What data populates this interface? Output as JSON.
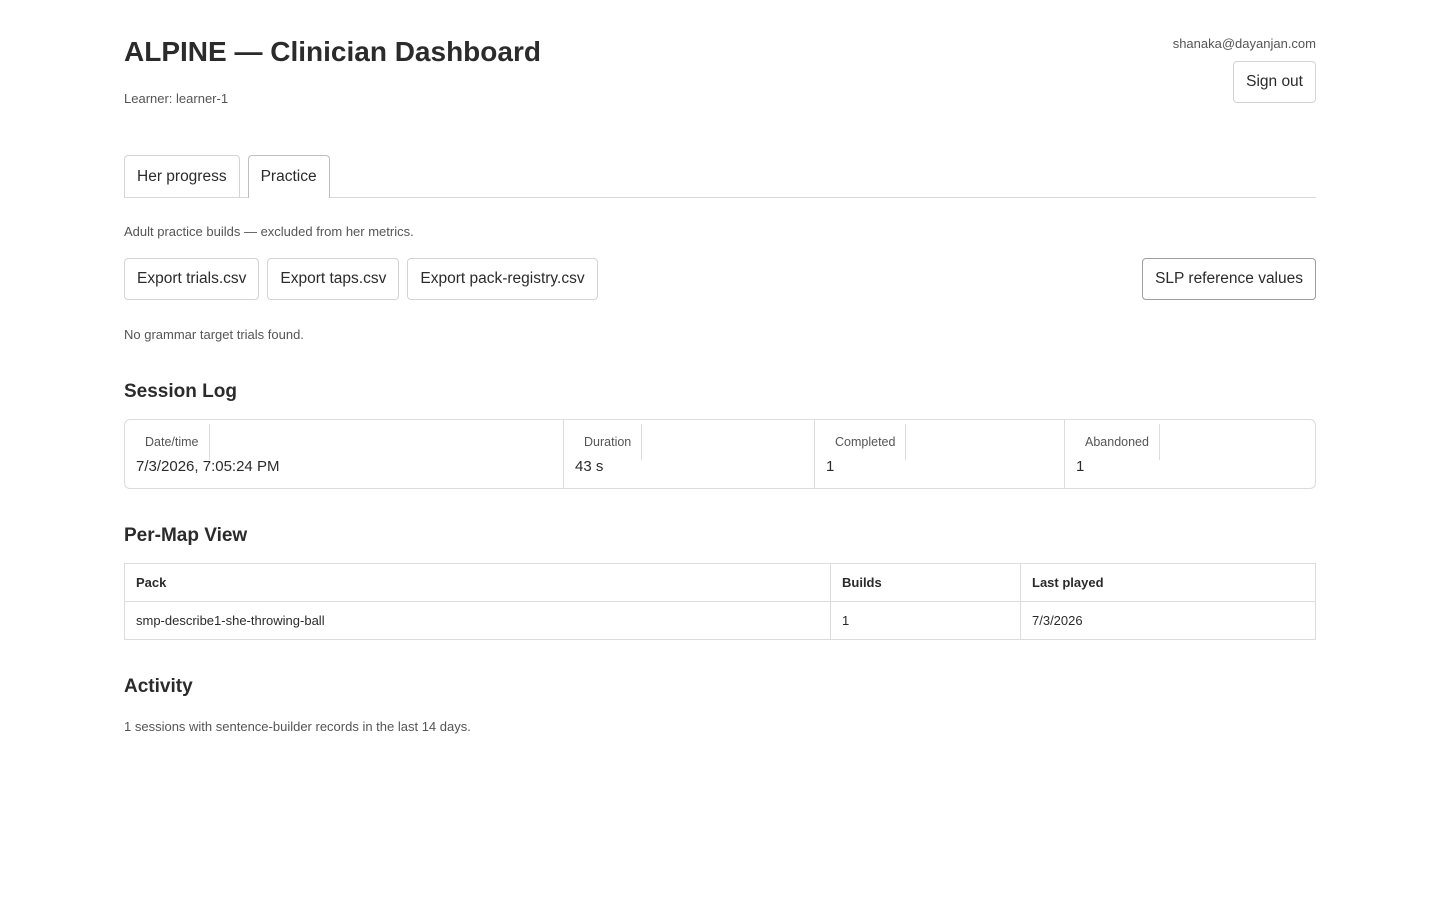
{
  "header": {
    "title": "ALPINE — Clinician Dashboard",
    "learner": "Learner: learner-1",
    "user_email": "shanaka@dayanjan.com",
    "sign_out_label": "Sign out"
  },
  "tabs": [
    {
      "label": "Her progress",
      "active": false
    },
    {
      "label": "Practice",
      "active": true
    }
  ],
  "practice": {
    "note": "Adult practice builds — excluded from her metrics.",
    "export_buttons": [
      "Export trials.csv",
      "Export taps.csv",
      "Export pack-registry.csv"
    ],
    "slp_button": "SLP reference values",
    "empty_message": "No grammar target trials found."
  },
  "session_log": {
    "title": "Session Log",
    "headers": [
      "Date/time",
      "Duration",
      "Completed",
      "Abandoned"
    ],
    "rows": [
      [
        "7/3/2026, 7:05:24 PM",
        "43 s",
        "1",
        "1"
      ]
    ]
  },
  "per_map": {
    "title": "Per-Map View",
    "headers": [
      "Pack",
      "Builds",
      "Last played"
    ],
    "rows": [
      [
        "smp-describe1-she-throwing-ball",
        "1",
        "7/3/2026"
      ]
    ]
  },
  "activity": {
    "title": "Activity",
    "text": "1 sessions with sentence-builder records in the last 14 days."
  }
}
